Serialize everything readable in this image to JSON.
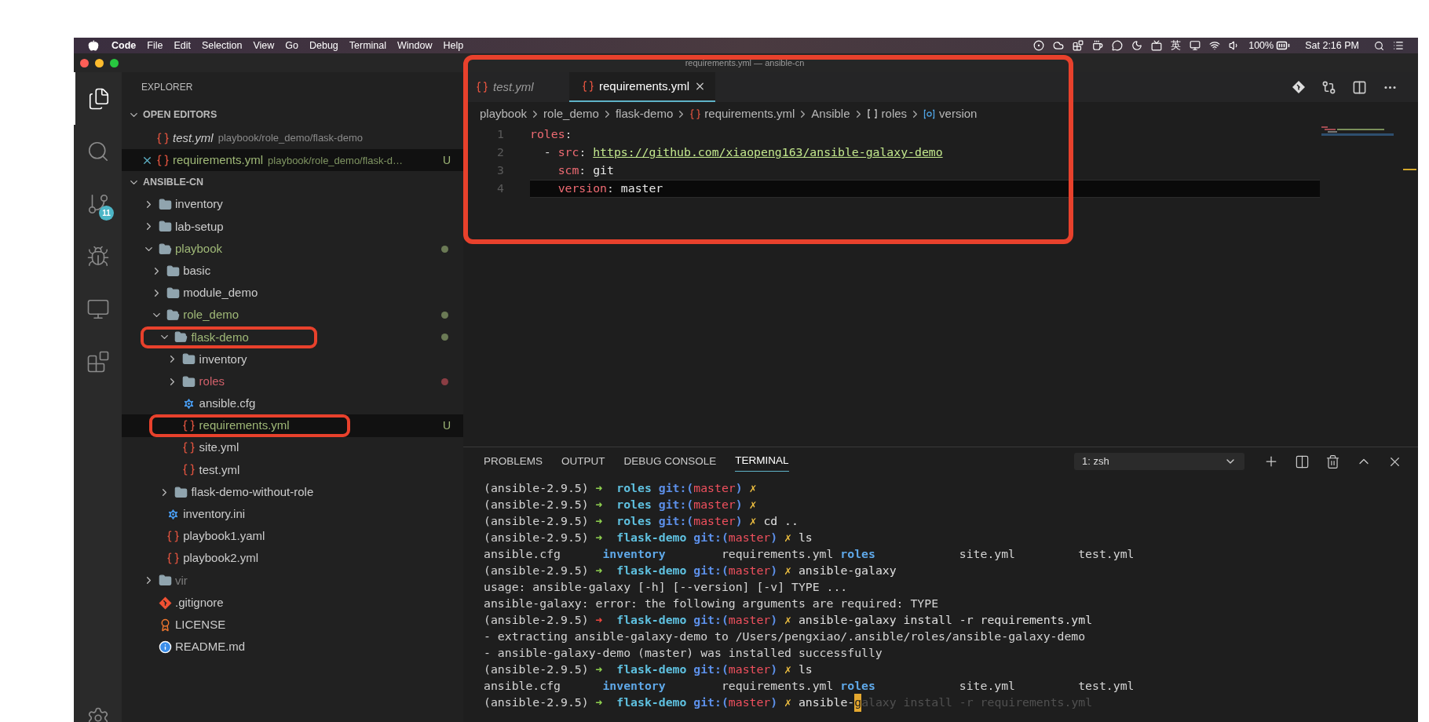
{
  "menubar": {
    "app": "Code",
    "menus": [
      "File",
      "Edit",
      "Selection",
      "View",
      "Go",
      "Debug",
      "Terminal",
      "Window",
      "Help"
    ],
    "input_method": "英",
    "battery": "100%",
    "clock": "Sat 2:16 PM"
  },
  "window": {
    "title": "requirements.yml — ansible-cn"
  },
  "activity_bar": {
    "items": [
      {
        "kind": "explorer",
        "selected": true
      },
      {
        "kind": "search",
        "selected": false
      },
      {
        "kind": "source_control",
        "selected": false,
        "badge": "11"
      },
      {
        "kind": "debug",
        "selected": false
      },
      {
        "kind": "remote",
        "selected": false
      },
      {
        "kind": "extensions",
        "selected": false
      }
    ]
  },
  "sidebar": {
    "title": "EXPLORER",
    "open_editors": {
      "title": "OPEN EDITORS",
      "expanded": true,
      "items": [
        {
          "name": "test.yml",
          "path": "playbook/role_demo/flask-demo",
          "preview": true,
          "selected": false
        },
        {
          "name": "requirements.yml",
          "path": "playbook/role_demo/flask-d…",
          "preview": false,
          "selected": true,
          "untracked": true,
          "badge": "U"
        }
      ]
    },
    "folder": {
      "title": "ANSIBLE-CN",
      "expanded": true,
      "tree": [
        {
          "name": "inventory",
          "kind": "folder",
          "expanded": false,
          "selected": false
        },
        {
          "name": "lab-setup",
          "kind": "folder",
          "expanded": false,
          "selected": false
        },
        {
          "name": "playbook",
          "kind": "folder",
          "expanded": true,
          "selected": false,
          "modified": true,
          "dot": true,
          "children": [
            {
              "name": "basic",
              "kind": "folder",
              "expanded": false,
              "selected": false
            },
            {
              "name": "module_demo",
              "kind": "folder",
              "expanded": false,
              "selected": false
            },
            {
              "name": "role_demo",
              "kind": "folder",
              "expanded": true,
              "selected": false,
              "modified": true,
              "dot": true,
              "children": [
                {
                  "name": "flask-demo",
                  "kind": "folder",
                  "expanded": true,
                  "selected": false,
                  "modified": true,
                  "dot": true,
                  "annotated": true,
                  "children": [
                    {
                      "name": "inventory",
                      "kind": "folder",
                      "expanded": false,
                      "selected": false
                    },
                    {
                      "name": "roles",
                      "kind": "folder",
                      "expanded": false,
                      "selected": false,
                      "error": true,
                      "dot": true
                    },
                    {
                      "name": "ansible.cfg",
                      "kind": "config",
                      "selected": false
                    },
                    {
                      "name": "requirements.yml",
                      "kind": "yaml",
                      "selected": true,
                      "untracked": true,
                      "badge": "U",
                      "annotated": true
                    },
                    {
                      "name": "site.yml",
                      "kind": "yaml",
                      "selected": false
                    },
                    {
                      "name": "test.yml",
                      "kind": "yaml",
                      "selected": false
                    }
                  ]
                },
                {
                  "name": "flask-demo-without-role",
                  "kind": "folder",
                  "expanded": false,
                  "selected": false
                }
              ]
            },
            {
              "name": "inventory.ini",
              "kind": "config",
              "selected": false
            },
            {
              "name": "playbook1.yaml",
              "kind": "yaml",
              "selected": false
            },
            {
              "name": "playbook2.yml",
              "kind": "yaml",
              "selected": false
            }
          ]
        },
        {
          "name": "vir",
          "kind": "folder",
          "expanded": false,
          "selected": false,
          "ignored": true
        },
        {
          "name": ".gitignore",
          "kind": "git",
          "selected": false
        },
        {
          "name": "LICENSE",
          "kind": "license",
          "selected": false
        },
        {
          "name": "README.md",
          "kind": "info",
          "selected": false
        }
      ]
    }
  },
  "editor": {
    "annotated": true,
    "tabs": [
      {
        "name": "test.yml",
        "preview": true,
        "selected": false
      },
      {
        "name": "requirements.yml",
        "preview": false,
        "selected": true
      }
    ],
    "breadcrumb": [
      {
        "kind": "folder",
        "text": "playbook"
      },
      {
        "kind": "folder",
        "text": "role_demo"
      },
      {
        "kind": "folder",
        "text": "flask-demo"
      },
      {
        "kind": "yaml",
        "text": "requirements.yml"
      },
      {
        "kind": "plain",
        "text": "Ansible"
      },
      {
        "kind": "array",
        "text": "roles"
      },
      {
        "kind": "field",
        "text": "version"
      }
    ],
    "lines": [
      {
        "number": "1",
        "current": false,
        "segments": [
          {
            "kind": "key",
            "text": "roles"
          },
          {
            "kind": "punct",
            "text": ":"
          }
        ]
      },
      {
        "number": "2",
        "current": false,
        "segments": [
          {
            "kind": "punct",
            "text": "  - "
          },
          {
            "kind": "key",
            "text": "src"
          },
          {
            "kind": "punct",
            "text": ": "
          },
          {
            "kind": "link",
            "text": "https://github.com/xiaopeng163/ansible-galaxy-demo"
          }
        ]
      },
      {
        "number": "3",
        "current": false,
        "segments": [
          {
            "kind": "key",
            "text": "    scm"
          },
          {
            "kind": "punct",
            "text": ": "
          },
          {
            "kind": "value",
            "text": "git"
          }
        ]
      },
      {
        "number": "4",
        "current": true,
        "segments": [
          {
            "kind": "key",
            "text": "    version"
          },
          {
            "kind": "punct",
            "text": ": "
          },
          {
            "kind": "value",
            "text": "master"
          }
        ]
      }
    ]
  },
  "panel": {
    "tabs": [
      {
        "label": "PROBLEMS",
        "selected": false
      },
      {
        "label": "OUTPUT",
        "selected": false
      },
      {
        "label": "DEBUG CONSOLE",
        "selected": false
      },
      {
        "label": "TERMINAL",
        "selected": true
      }
    ],
    "terminal_select": "1: zsh",
    "terminal": [
      {
        "kind": "prompt",
        "env": "(ansible-2.9.5)",
        "arrow": "➜",
        "failed": false,
        "dir": "roles",
        "git": "git:(",
        "branch": "master",
        "git_end": ")",
        "mark": "✗"
      },
      {
        "kind": "prompt",
        "env": "(ansible-2.9.5)",
        "arrow": "➜",
        "failed": false,
        "dir": "roles",
        "git": "git:(",
        "branch": "master",
        "git_end": ")",
        "mark": "✗"
      },
      {
        "kind": "prompt",
        "env": "(ansible-2.9.5)",
        "arrow": "➜",
        "failed": false,
        "dir": "roles",
        "git": "git:(",
        "branch": "master",
        "git_end": ")",
        "mark": "✗",
        "command": "cd .."
      },
      {
        "kind": "prompt",
        "env": "(ansible-2.9.5)",
        "arrow": "➜",
        "failed": false,
        "dir": "flask-demo",
        "git": "git:(",
        "branch": "master",
        "git_end": ")",
        "mark": "✗",
        "command": "ls"
      },
      {
        "kind": "listing",
        "entries": [
          {
            "name": "ansible.cfg",
            "folder": false
          },
          {
            "name": "inventory",
            "folder": true
          },
          {
            "name": "requirements.yml",
            "folder": false
          },
          {
            "name": "roles",
            "folder": true
          },
          {
            "name": "site.yml",
            "folder": false
          },
          {
            "name": "test.yml",
            "folder": false
          }
        ]
      },
      {
        "kind": "prompt",
        "env": "(ansible-2.9.5)",
        "arrow": "➜",
        "failed": false,
        "dir": "flask-demo",
        "git": "git:(",
        "branch": "master",
        "git_end": ")",
        "mark": "✗",
        "command": "ansible-galaxy"
      },
      {
        "kind": "output",
        "text": "usage: ansible-galaxy [-h] [--version] [-v] TYPE ..."
      },
      {
        "kind": "output",
        "text": "ansible-galaxy: error: the following arguments are required: TYPE"
      },
      {
        "kind": "prompt",
        "env": "(ansible-2.9.5)",
        "arrow": "➜",
        "failed": true,
        "dir": "flask-demo",
        "git": "git:(",
        "branch": "master",
        "git_end": ")",
        "mark": "✗",
        "command": "ansible-galaxy install -r requirements.yml"
      },
      {
        "kind": "output",
        "text": "- extracting ansible-galaxy-demo to /Users/pengxiao/.ansible/roles/ansible-galaxy-demo"
      },
      {
        "kind": "output",
        "text": "- ansible-galaxy-demo (master) was installed successfully"
      },
      {
        "kind": "prompt",
        "env": "(ansible-2.9.5)",
        "arrow": "➜",
        "failed": false,
        "dir": "flask-demo",
        "git": "git:(",
        "branch": "master",
        "git_end": ")",
        "mark": "✗",
        "command": "ls"
      },
      {
        "kind": "listing",
        "entries": [
          {
            "name": "ansible.cfg",
            "folder": false
          },
          {
            "name": "inventory",
            "folder": true
          },
          {
            "name": "requirements.yml",
            "folder": false
          },
          {
            "name": "roles",
            "folder": true
          },
          {
            "name": "site.yml",
            "folder": false
          },
          {
            "name": "test.yml",
            "folder": false
          }
        ]
      },
      {
        "kind": "prompt",
        "env": "(ansible-2.9.5)",
        "arrow": "➜",
        "failed": false,
        "dir": "flask-demo",
        "git": "git:(",
        "branch": "master",
        "git_end": ")",
        "mark": "✗",
        "command": "ansible-",
        "cursor": "g",
        "suggestion": "alaxy install -r requirements.yml"
      }
    ]
  }
}
